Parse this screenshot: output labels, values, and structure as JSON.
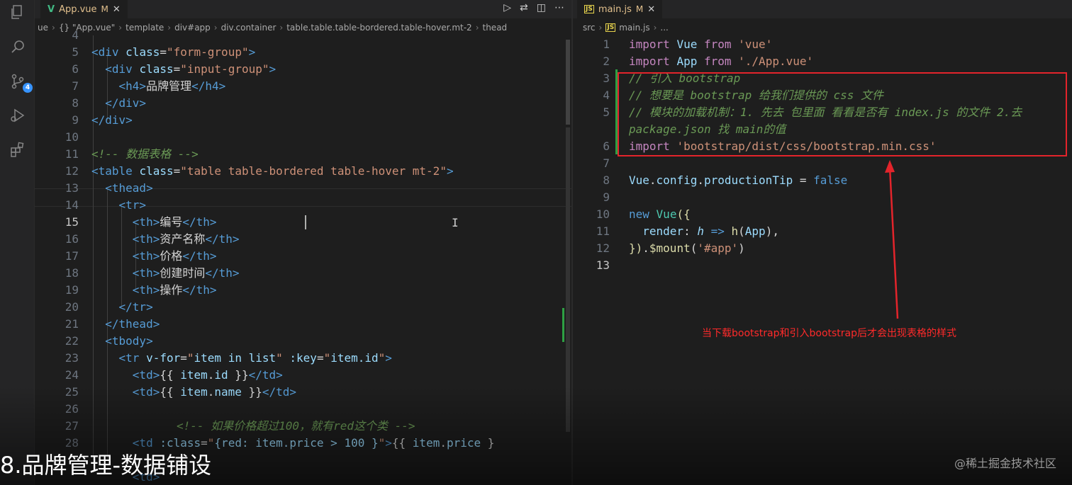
{
  "left_editor": {
    "tab": {
      "name": "App.vue",
      "status": "M"
    },
    "breadcrumb": [
      "ue",
      "{} \"App.vue\"",
      "template",
      "div#app",
      "div.container",
      "table.table.table-bordered.table-hover.mt-2",
      "thead"
    ],
    "lines": [
      {
        "n": "4"
      },
      {
        "n": "5"
      },
      {
        "n": "6"
      },
      {
        "n": "7"
      },
      {
        "n": "8"
      },
      {
        "n": "9"
      },
      {
        "n": "10"
      },
      {
        "n": "11"
      },
      {
        "n": "12"
      },
      {
        "n": "13"
      },
      {
        "n": "14"
      },
      {
        "n": "15"
      },
      {
        "n": "16"
      },
      {
        "n": "17"
      },
      {
        "n": "18"
      },
      {
        "n": "19"
      },
      {
        "n": "20"
      },
      {
        "n": "21"
      },
      {
        "n": "22"
      },
      {
        "n": "23"
      },
      {
        "n": "24"
      },
      {
        "n": "25"
      },
      {
        "n": "26"
      },
      {
        "n": "27"
      },
      {
        "n": "28"
      }
    ],
    "code": {
      "l5_tag": "form-group",
      "l6_tag": "input-group",
      "l7_text": "品牌管理",
      "l11_comment": "<!-- 数据表格 -->",
      "l12_class": "table table-bordered table-hover mt-2",
      "th1": "编号",
      "th2": "资产名称",
      "th3": "价格",
      "th4": "创建时间",
      "th5": "操作",
      "l23_vfor": "item in list",
      "l23_key": "item.id",
      "l27_comment": "<!-- 如果价格超过100，就有red这个类 -->",
      "l28_class": "{red: item.price > 100 }"
    }
  },
  "right_editor": {
    "tab": {
      "name": "main.js",
      "status": "M"
    },
    "breadcrumb": [
      "src",
      "main.js",
      "..."
    ],
    "lines": [
      "1",
      "2",
      "3",
      "4",
      "5",
      "",
      "6",
      "7",
      "8",
      "9",
      "10",
      "11",
      "12",
      "13"
    ],
    "code": {
      "l1": {
        "kw": "import",
        "name": "Vue",
        "from": "from",
        "src": "'vue'"
      },
      "l2": {
        "kw": "import",
        "name": "App",
        "from": "from",
        "src": "'./App.vue'"
      },
      "l3": "// 引入 bootstrap",
      "l4": "// 想要是 bootstrap 给我们提供的 css 文件",
      "l5a": "// 模块的加载机制：1. 先去 包里面 看看是否有 index.js 的文件 2.去",
      "l5b": "package.json 找 main的值",
      "l6": {
        "kw": "import",
        "src": "'bootstrap/dist/css/bootstrap.min.css'"
      },
      "l8": {
        "obj": "Vue",
        "p1": "config",
        "p2": "productionTip",
        "eq": " = ",
        "val": "false"
      },
      "l10": {
        "kw": "new",
        "cls": "Vue",
        "rest": "({"
      },
      "l11": {
        "key": "render",
        "param": "h",
        "arrow": " => ",
        "fn": "h",
        "arg": "App"
      },
      "l12": {
        "close": "})",
        "method": "$mount",
        "arg": "'#app'"
      }
    }
  },
  "annotation": "当下载bootstrap和引入bootstrap后才会出现表格的样式",
  "caption": "8.品牌管理-数据铺设",
  "watermark": "@稀土掘金技术社区",
  "activity_badge": "4",
  "colors": {
    "annotation": "#e3242b",
    "tag": "#569cd6",
    "attr": "#9cdcfe",
    "string": "#ce9178",
    "comment": "#6a9955"
  }
}
